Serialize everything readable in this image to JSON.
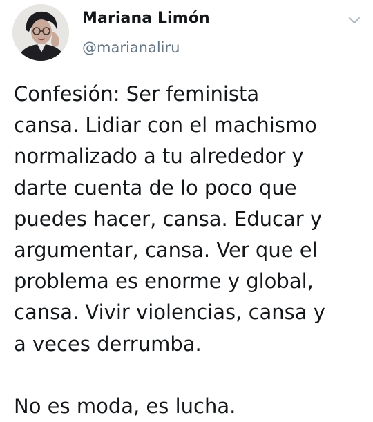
{
  "author": {
    "display_name": "Mariana Limón",
    "handle": "@marianaliru"
  },
  "icons": {
    "avatar": "profile-photo",
    "menu": "chevron-down-icon"
  },
  "tweet": {
    "text": "Confesión: Ser feminista\ncansa. Lidiar con el machismo\nnormalizado a tu alrededor y\ndarte cuenta de lo poco que\npuedes hacer, cansa. Educar y\nargumentar, cansa. Ver que el\nproblema es enorme y global,\ncansa. Vivir violencias, cansa y\na veces derrumba.\n\nNo es moda, es lucha."
  },
  "colors": {
    "name": "#14171a",
    "handle": "#657786",
    "chevron": "#aab8c2",
    "background": "#ffffff"
  }
}
